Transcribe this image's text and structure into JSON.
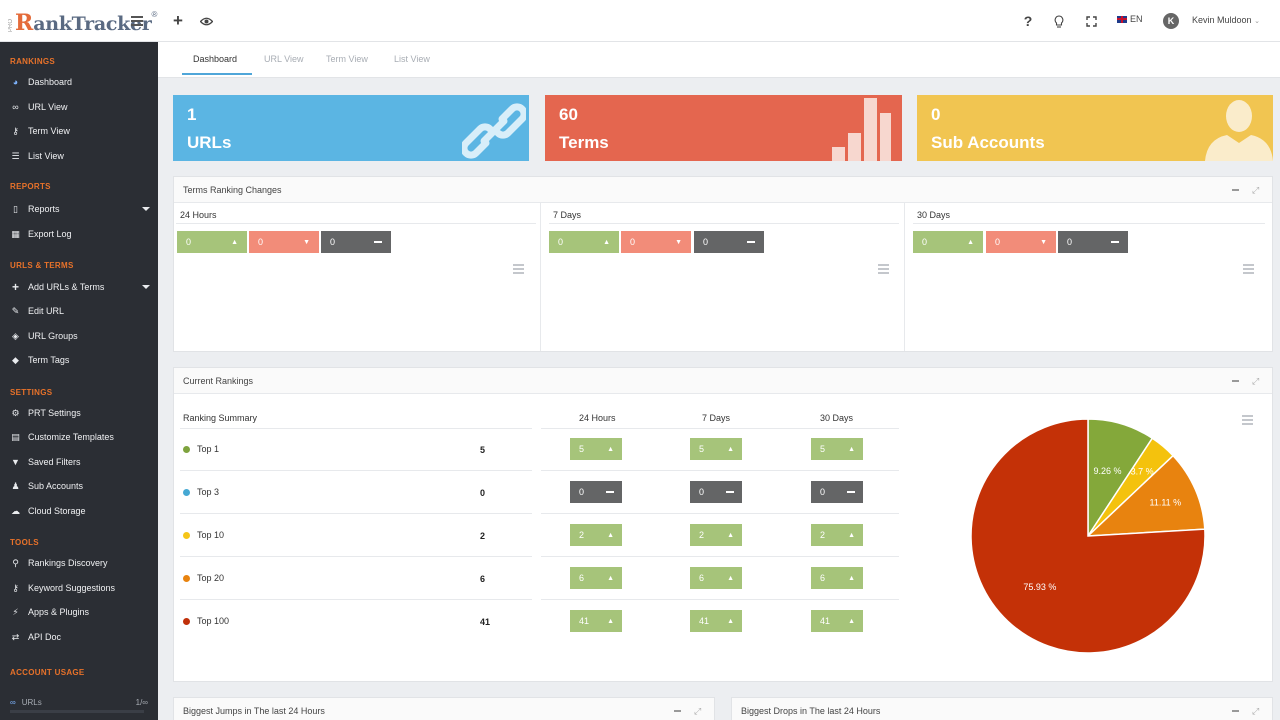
{
  "header": {
    "logo_prefix": "PRO",
    "logo_r": "R",
    "logo_text": "ankTracker",
    "logo_mark": "®",
    "icons": [
      "hamburger-icon",
      "plus-icon",
      "eye-icon",
      "question-icon",
      "lightbulb-icon",
      "fullscreen-icon"
    ],
    "language": "EN",
    "avatar_initial": "K",
    "user_name": "Kevin Muldoon"
  },
  "sidebar": {
    "sections": [
      {
        "title": "RANKINGS",
        "items": [
          {
            "label": "Dashboard",
            "icon": "dashboard-icon"
          },
          {
            "label": "URL View",
            "icon": "link-icon"
          },
          {
            "label": "Term View",
            "icon": "key-icon"
          },
          {
            "label": "List View",
            "icon": "list-icon"
          }
        ]
      },
      {
        "title": "REPORTS",
        "items": [
          {
            "label": "Reports",
            "icon": "file-icon"
          },
          {
            "label": "Export Log",
            "icon": "table-icon"
          }
        ]
      },
      {
        "title": "URLS & TERMS",
        "items": [
          {
            "label": "Add URLs & Terms",
            "icon": "plus-icon"
          },
          {
            "label": "Edit URL",
            "icon": "edit-icon"
          },
          {
            "label": "URL Groups",
            "icon": "layers-icon"
          },
          {
            "label": "Term Tags",
            "icon": "tag-icon"
          }
        ]
      },
      {
        "title": "SETTINGS",
        "items": [
          {
            "label": "PRT Settings",
            "icon": "gear-icon"
          },
          {
            "label": "Customize Templates",
            "icon": "template-icon"
          },
          {
            "label": "Saved Filters",
            "icon": "filter-icon"
          },
          {
            "label": "Sub Accounts",
            "icon": "users-icon"
          },
          {
            "label": "Cloud Storage",
            "icon": "cloud-icon"
          }
        ]
      },
      {
        "title": "TOOLS",
        "items": [
          {
            "label": "Rankings Discovery",
            "icon": "search-icon"
          },
          {
            "label": "Keyword Suggestions",
            "icon": "key-icon"
          },
          {
            "label": "Apps & Plugins",
            "icon": "plug-icon"
          },
          {
            "label": "API Doc",
            "icon": "exchange-icon"
          }
        ]
      },
      {
        "title": "ACCOUNT USAGE",
        "items": []
      }
    ],
    "usage": {
      "label": "URLs",
      "value": "1/∞"
    }
  },
  "subtabs": [
    "Dashboard",
    "URL View",
    "Term View",
    "List View"
  ],
  "stats": [
    {
      "value": "1",
      "label": "URLs",
      "color": "#5bb5e3",
      "icon": "chain-link-icon"
    },
    {
      "value": "60",
      "label": "Terms",
      "color": "#e4664f",
      "icon": "bar-chart-icon"
    },
    {
      "value": "0",
      "label": "Sub Accounts",
      "color": "#f1c551",
      "icon": "person-silhouette-icon"
    }
  ],
  "terms_ranking_changes": {
    "title": "Terms Ranking Changes",
    "columns": [
      {
        "title": "24 Hours",
        "up": "0",
        "down": "0",
        "same": "0"
      },
      {
        "title": "7 Days",
        "up": "0",
        "down": "0",
        "same": "0"
      },
      {
        "title": "30 Days",
        "up": "0",
        "down": "0",
        "same": "0"
      }
    ]
  },
  "current_rankings": {
    "title": "Current Rankings",
    "headers": {
      "summary": "Ranking Summary",
      "h24": "24 Hours",
      "d7": "7 Days",
      "d30": "30 Days"
    },
    "rows": [
      {
        "label": "Top 1",
        "count": "5",
        "dot": "#7ea33e",
        "h24": "5",
        "d7": "5",
        "d30": "5",
        "trend": "up"
      },
      {
        "label": "Top 3",
        "count": "0",
        "dot": "#45a8d3",
        "h24": "0",
        "d7": "0",
        "d30": "0",
        "trend": "same"
      },
      {
        "label": "Top 10",
        "count": "2",
        "dot": "#f5c518",
        "h24": "2",
        "d7": "2",
        "d30": "2",
        "trend": "up"
      },
      {
        "label": "Top 20",
        "count": "6",
        "dot": "#e8830f",
        "h24": "6",
        "d7": "6",
        "d30": "6",
        "trend": "up"
      },
      {
        "label": "Top 100",
        "count": "41",
        "dot": "#c0300a",
        "h24": "41",
        "d7": "41",
        "d30": "41",
        "trend": "up"
      }
    ]
  },
  "chart_data": {
    "type": "pie",
    "slices": [
      {
        "label": "9.26 %",
        "value": 9.26,
        "color": "#84a83a"
      },
      {
        "label": "3.7 %",
        "value": 3.7,
        "color": "#f4c20d"
      },
      {
        "label": "11.11 %",
        "value": 11.11,
        "color": "#e8830f"
      },
      {
        "label": "75.93 %",
        "value": 75.93,
        "color": "#c43107"
      }
    ]
  },
  "bottom_panels": {
    "jumps_title": "Biggest Jumps in The last 24 Hours",
    "drops_title": "Biggest Drops in The last 24 Hours"
  }
}
